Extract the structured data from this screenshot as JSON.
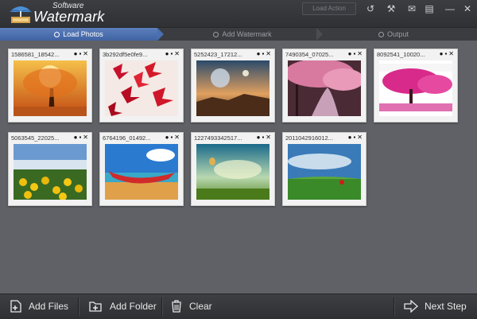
{
  "app": {
    "brand_small": "Software",
    "brand_big": "Watermark",
    "titlebar_button": "Load Action"
  },
  "steps": [
    {
      "label": "Load Photos",
      "active": true
    },
    {
      "label": "Add Watermark",
      "active": false
    },
    {
      "label": "Output",
      "active": false
    }
  ],
  "photos": [
    {
      "filename": "1586581_18542...",
      "scene": "autumn-tree"
    },
    {
      "filename": "3b292df5e0fe9...",
      "scene": "red-leaves"
    },
    {
      "filename": "5252423_17212...",
      "scene": "planets-sunset"
    },
    {
      "filename": "7490354_07025...",
      "scene": "cherry-stream"
    },
    {
      "filename": "8092541_10020...",
      "scene": "pink-tree"
    },
    {
      "filename": "5063545_22025...",
      "scene": "sunflowers"
    },
    {
      "filename": "6764196_01492...",
      "scene": "red-boat"
    },
    {
      "filename": "1227493342517...",
      "scene": "balloon-sky"
    },
    {
      "filename": "2011042916012...",
      "scene": "green-field"
    }
  ],
  "toolbar": {
    "add_files": "Add Files",
    "add_folder": "Add Folder",
    "clear": "Clear",
    "next_step": "Next Step"
  },
  "colors": {
    "background": "#5f6166",
    "accent": "#4a6fb0"
  }
}
